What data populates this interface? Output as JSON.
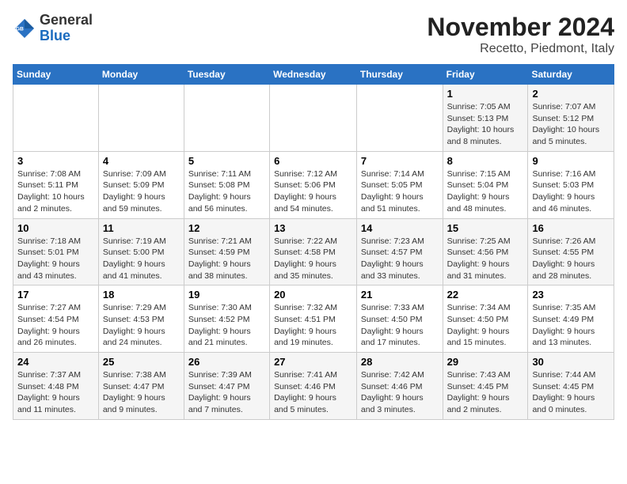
{
  "header": {
    "logo_line1": "General",
    "logo_line2": "Blue",
    "month_title": "November 2024",
    "location": "Recetto, Piedmont, Italy"
  },
  "weekdays": [
    "Sunday",
    "Monday",
    "Tuesday",
    "Wednesday",
    "Thursday",
    "Friday",
    "Saturday"
  ],
  "weeks": [
    [
      {
        "day": "",
        "info": ""
      },
      {
        "day": "",
        "info": ""
      },
      {
        "day": "",
        "info": ""
      },
      {
        "day": "",
        "info": ""
      },
      {
        "day": "",
        "info": ""
      },
      {
        "day": "1",
        "info": "Sunrise: 7:05 AM\nSunset: 5:13 PM\nDaylight: 10 hours\nand 8 minutes."
      },
      {
        "day": "2",
        "info": "Sunrise: 7:07 AM\nSunset: 5:12 PM\nDaylight: 10 hours\nand 5 minutes."
      }
    ],
    [
      {
        "day": "3",
        "info": "Sunrise: 7:08 AM\nSunset: 5:11 PM\nDaylight: 10 hours\nand 2 minutes."
      },
      {
        "day": "4",
        "info": "Sunrise: 7:09 AM\nSunset: 5:09 PM\nDaylight: 9 hours\nand 59 minutes."
      },
      {
        "day": "5",
        "info": "Sunrise: 7:11 AM\nSunset: 5:08 PM\nDaylight: 9 hours\nand 56 minutes."
      },
      {
        "day": "6",
        "info": "Sunrise: 7:12 AM\nSunset: 5:06 PM\nDaylight: 9 hours\nand 54 minutes."
      },
      {
        "day": "7",
        "info": "Sunrise: 7:14 AM\nSunset: 5:05 PM\nDaylight: 9 hours\nand 51 minutes."
      },
      {
        "day": "8",
        "info": "Sunrise: 7:15 AM\nSunset: 5:04 PM\nDaylight: 9 hours\nand 48 minutes."
      },
      {
        "day": "9",
        "info": "Sunrise: 7:16 AM\nSunset: 5:03 PM\nDaylight: 9 hours\nand 46 minutes."
      }
    ],
    [
      {
        "day": "10",
        "info": "Sunrise: 7:18 AM\nSunset: 5:01 PM\nDaylight: 9 hours\nand 43 minutes."
      },
      {
        "day": "11",
        "info": "Sunrise: 7:19 AM\nSunset: 5:00 PM\nDaylight: 9 hours\nand 41 minutes."
      },
      {
        "day": "12",
        "info": "Sunrise: 7:21 AM\nSunset: 4:59 PM\nDaylight: 9 hours\nand 38 minutes."
      },
      {
        "day": "13",
        "info": "Sunrise: 7:22 AM\nSunset: 4:58 PM\nDaylight: 9 hours\nand 35 minutes."
      },
      {
        "day": "14",
        "info": "Sunrise: 7:23 AM\nSunset: 4:57 PM\nDaylight: 9 hours\nand 33 minutes."
      },
      {
        "day": "15",
        "info": "Sunrise: 7:25 AM\nSunset: 4:56 PM\nDaylight: 9 hours\nand 31 minutes."
      },
      {
        "day": "16",
        "info": "Sunrise: 7:26 AM\nSunset: 4:55 PM\nDaylight: 9 hours\nand 28 minutes."
      }
    ],
    [
      {
        "day": "17",
        "info": "Sunrise: 7:27 AM\nSunset: 4:54 PM\nDaylight: 9 hours\nand 26 minutes."
      },
      {
        "day": "18",
        "info": "Sunrise: 7:29 AM\nSunset: 4:53 PM\nDaylight: 9 hours\nand 24 minutes."
      },
      {
        "day": "19",
        "info": "Sunrise: 7:30 AM\nSunset: 4:52 PM\nDaylight: 9 hours\nand 21 minutes."
      },
      {
        "day": "20",
        "info": "Sunrise: 7:32 AM\nSunset: 4:51 PM\nDaylight: 9 hours\nand 19 minutes."
      },
      {
        "day": "21",
        "info": "Sunrise: 7:33 AM\nSunset: 4:50 PM\nDaylight: 9 hours\nand 17 minutes."
      },
      {
        "day": "22",
        "info": "Sunrise: 7:34 AM\nSunset: 4:50 PM\nDaylight: 9 hours\nand 15 minutes."
      },
      {
        "day": "23",
        "info": "Sunrise: 7:35 AM\nSunset: 4:49 PM\nDaylight: 9 hours\nand 13 minutes."
      }
    ],
    [
      {
        "day": "24",
        "info": "Sunrise: 7:37 AM\nSunset: 4:48 PM\nDaylight: 9 hours\nand 11 minutes."
      },
      {
        "day": "25",
        "info": "Sunrise: 7:38 AM\nSunset: 4:47 PM\nDaylight: 9 hours\nand 9 minutes."
      },
      {
        "day": "26",
        "info": "Sunrise: 7:39 AM\nSunset: 4:47 PM\nDaylight: 9 hours\nand 7 minutes."
      },
      {
        "day": "27",
        "info": "Sunrise: 7:41 AM\nSunset: 4:46 PM\nDaylight: 9 hours\nand 5 minutes."
      },
      {
        "day": "28",
        "info": "Sunrise: 7:42 AM\nSunset: 4:46 PM\nDaylight: 9 hours\nand 3 minutes."
      },
      {
        "day": "29",
        "info": "Sunrise: 7:43 AM\nSunset: 4:45 PM\nDaylight: 9 hours\nand 2 minutes."
      },
      {
        "day": "30",
        "info": "Sunrise: 7:44 AM\nSunset: 4:45 PM\nDaylight: 9 hours\nand 0 minutes."
      }
    ]
  ]
}
